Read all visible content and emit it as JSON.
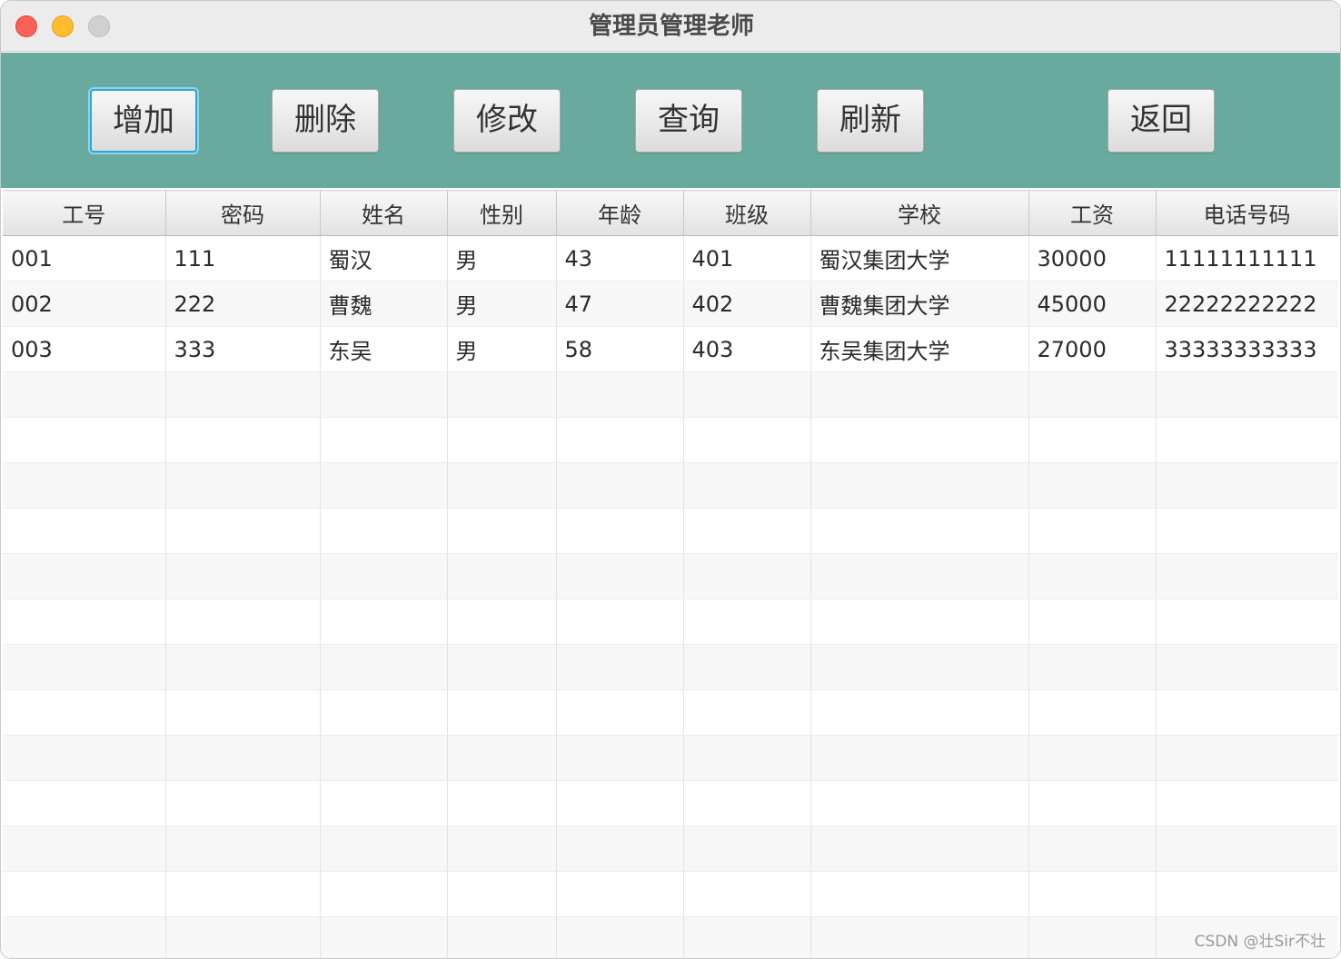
{
  "window": {
    "title": "管理员管理老师"
  },
  "toolbar": {
    "buttons": [
      {
        "label": "增加"
      },
      {
        "label": "删除"
      },
      {
        "label": "修改"
      },
      {
        "label": "查询"
      },
      {
        "label": "刷新"
      },
      {
        "label": "返回"
      }
    ]
  },
  "table": {
    "columns": [
      "工号",
      "密码",
      "姓名",
      "性别",
      "年龄",
      "班级",
      "学校",
      "工资",
      "电话号码"
    ],
    "rows": [
      [
        "001",
        "111",
        "蜀汉",
        "男",
        "43",
        "401",
        "蜀汉集团大学",
        "30000",
        "11111111111"
      ],
      [
        "002",
        "222",
        "曹魏",
        "男",
        "47",
        "402",
        "曹魏集团大学",
        "45000",
        "22222222222"
      ],
      [
        "003",
        "333",
        "东吴",
        "男",
        "58",
        "403",
        "东吴集团大学",
        "27000",
        "33333333333"
      ]
    ],
    "empty_rows": 13
  },
  "watermark": "CSDN @壮Sir不壮",
  "colors": {
    "toolbar_bg": "#69aa9e",
    "focus_ring": "#2aa7d9"
  }
}
